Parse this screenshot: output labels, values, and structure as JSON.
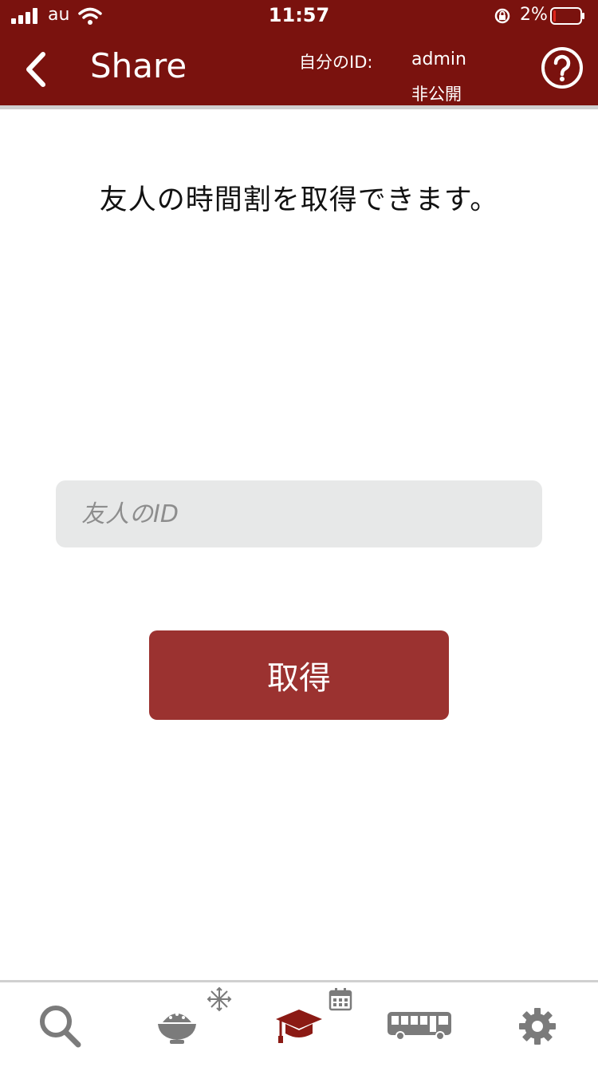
{
  "status_bar": {
    "carrier": "au",
    "time": "11:57",
    "battery": "2%"
  },
  "nav": {
    "title": "Share",
    "my_id_label": "自分のID:",
    "my_id_value": "admin",
    "my_id_visibility": "非公開"
  },
  "main": {
    "intro": "友人の時間割を取得できます。",
    "friend_id_placeholder": "友人のID",
    "get_button": "取得"
  },
  "colors": {
    "header": "#7a120e",
    "button": "#9b3230",
    "active_tab": "#8b1a14",
    "inactive_tab": "#7b7b7b"
  },
  "tabs": [
    {
      "icon": "search-icon",
      "active": false
    },
    {
      "icon": "rice-bowl-icon",
      "active": false
    },
    {
      "icon": "graduation-cap-icon",
      "active": true
    },
    {
      "icon": "bus-icon",
      "active": false
    },
    {
      "icon": "gear-icon",
      "active": false
    }
  ]
}
